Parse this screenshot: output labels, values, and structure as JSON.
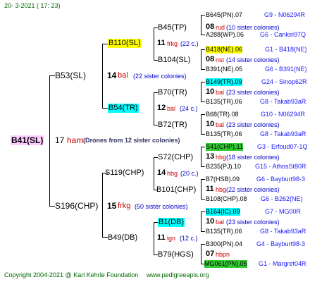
{
  "header": {
    "date": "20-  3-2021  ( 17:  23)"
  },
  "root": {
    "name": "B41(SL)",
    "gen": "17",
    "mark": "ham",
    "note": "(Drones from 12 sister colonies)"
  },
  "level1": [
    {
      "name": "B53(SL)",
      "gen": "14",
      "mark": "bal",
      "note": "(22 sister colonies)"
    },
    {
      "name": "S196(CHP)",
      "gen": "15",
      "mark": "frkg",
      "note": "(50 sister colonies)"
    }
  ],
  "level2": [
    {
      "name": "B110(SL)",
      "gen": "11",
      "mark": "frkg",
      "note": "(22 c.)"
    },
    {
      "name": "B54(TR)",
      "gen": "12",
      "mark": "bal",
      "note": "(24 c.)"
    },
    {
      "name": "S119(CHP)",
      "gen": "14",
      "mark": "hbg",
      "note": "(20 c.)"
    },
    {
      "name": "B49(DB)",
      "gen": "11",
      "mark": "lgn",
      "note": "(12 c.)"
    }
  ],
  "level3": [
    {
      "name": "B45(TP)",
      "gen": "08",
      "mark": "rud",
      "note": "(10 sister colonies)"
    },
    {
      "name": "B104(SL)",
      "gen": "08",
      "mark": "nst",
      "note": "(14 sister colonies)"
    },
    {
      "name": "B70(TR)",
      "gen": "10",
      "mark": "bal",
      "note": "(23 sister colonies)"
    },
    {
      "name": "B72(TR)",
      "gen": "10",
      "mark": "bal",
      "note": "(23 sister colonies)"
    },
    {
      "name": "S72(CHP)",
      "gen": "13",
      "mark": "hbg",
      "note": "(18 sister colonies)"
    },
    {
      "name": "B101(CHP)",
      "gen": "11",
      "mark": "hbg",
      "note": "(22 sister colonies)"
    },
    {
      "name": "B1(DB)",
      "gen": "10",
      "mark": "bal",
      "note": "(23 sister colonies)"
    },
    {
      "name": "B79(HGS)",
      "gen": "07",
      "mark": "hbpn",
      "note": ""
    }
  ],
  "level4": [
    {
      "name": "B645(PN).07",
      "code": "G9 - N06294R"
    },
    {
      "name": "A288(WP).06",
      "code": "G6 - Cankiri97Q"
    },
    {
      "name": "B418(NE).06",
      "code": "G1 - B418(NE)"
    },
    {
      "name": "B391(NE).05",
      "code": "G6 - B391(NE)"
    },
    {
      "name": "B149(TR).09",
      "code": "G24 - Sinop62R"
    },
    {
      "name": "B135(TR).06",
      "code": "G8 - Takab93aR"
    },
    {
      "name": "B68(TR).08",
      "code": "G10 - N06294R"
    },
    {
      "name": "B135(TR).06",
      "code": "G8 - Takab93aR"
    },
    {
      "name": "S41(CHP).11",
      "code": "G3 - Erfoud07-1Q"
    },
    {
      "name": "B235(PJ).10",
      "code": "G15 - AthosSt80R"
    },
    {
      "name": "B7(HSB).09",
      "code": "G6 - Bayburt98-3"
    },
    {
      "name": "B108(CHP).08",
      "code": "G6 - B262(NE)"
    },
    {
      "name": "B164(IC).09",
      "code": "G7 - MG00R"
    },
    {
      "name": "B135(TR).06",
      "code": "G8 - Takab93aR"
    },
    {
      "name": "B300(PN).04",
      "code": "G4 - Bayburt98-3"
    },
    {
      "name": "MG061(PN).05",
      "code": "G1 - Margret04R"
    }
  ],
  "footer": {
    "copyright": "Copyright 2004-2021 @ Karl Kehrle Foundation",
    "url": "www.pedigreeapis.org"
  }
}
